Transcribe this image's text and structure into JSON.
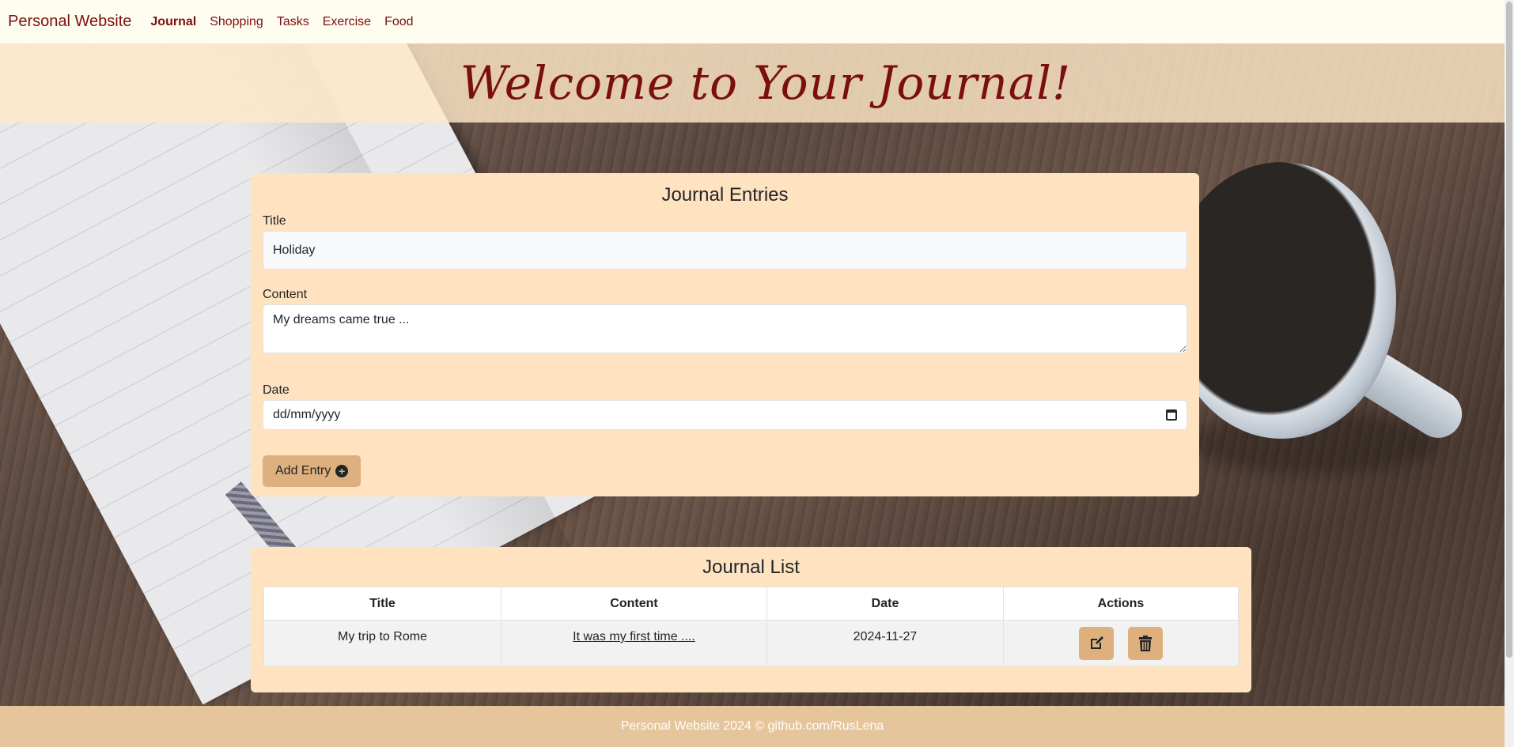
{
  "navbar": {
    "brand": "Personal Website",
    "links": [
      {
        "label": "Journal",
        "active": true
      },
      {
        "label": "Shopping",
        "active": false
      },
      {
        "label": "Tasks",
        "active": false
      },
      {
        "label": "Exercise",
        "active": false
      },
      {
        "label": "Food",
        "active": false
      }
    ]
  },
  "header": {
    "title": "Welcome to Your Journal!"
  },
  "form": {
    "heading": "Journal Entries",
    "title_label": "Title",
    "title_value": "Holiday",
    "content_label": "Content",
    "content_value": "My dreams came true ...",
    "date_label": "Date",
    "date_placeholder": "dd/mm/yyyy",
    "add_button_label": "Add Entry",
    "add_icon": "plus-circle-icon"
  },
  "list": {
    "heading": "Journal List",
    "columns": [
      "Title",
      "Content",
      "Date",
      "Actions"
    ],
    "rows": [
      {
        "title": "My trip to Rome",
        "content": "It was my first time ....",
        "date": "2024-11-27"
      }
    ],
    "row_actions": [
      "edit-icon",
      "trash-icon"
    ]
  },
  "footer": {
    "text": "Personal Website 2024 © github.com/RusLena"
  },
  "colors": {
    "brand": "#7b0f0f",
    "card": "#ffe3c0",
    "button": "#deb07e",
    "footer": "#e5c59c",
    "navbar": "#fffdf0"
  }
}
